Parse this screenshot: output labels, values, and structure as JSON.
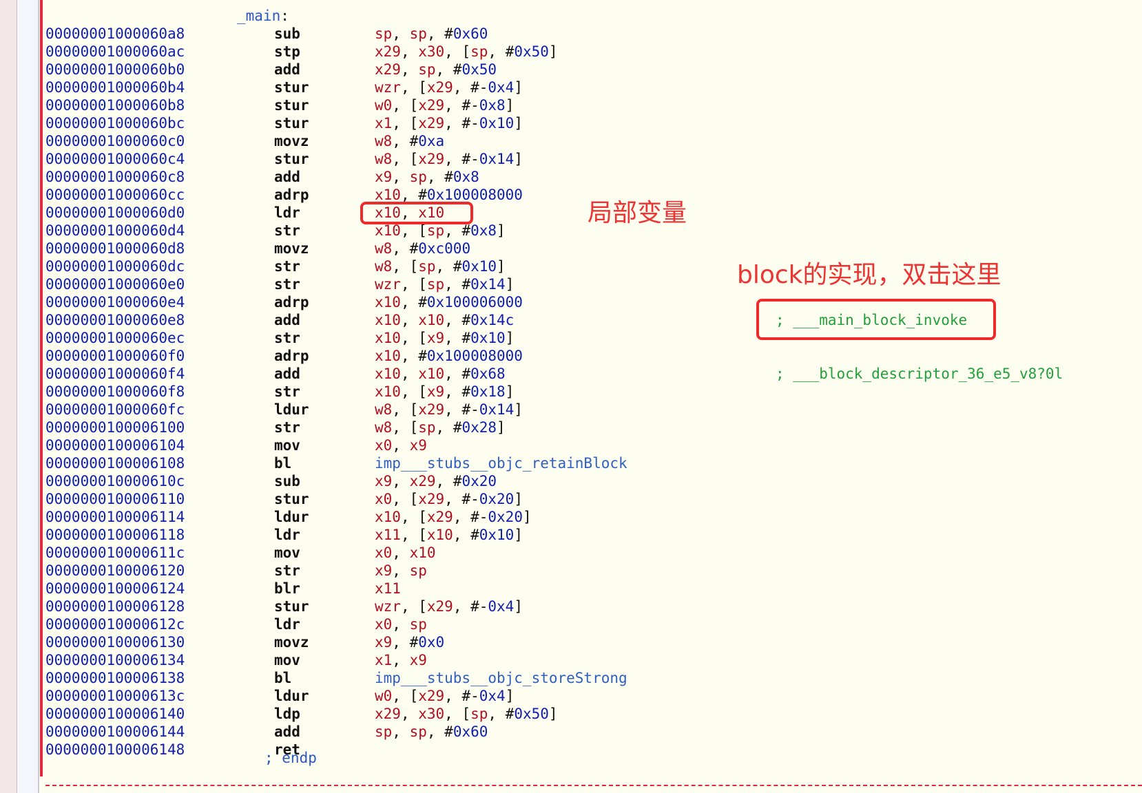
{
  "function_label": "_main",
  "instructions": [
    {
      "addr": "00000001000060a8",
      "mnemonic": "sub",
      "operands": [
        [
          "reg",
          "sp"
        ],
        [
          "pun",
          ", "
        ],
        [
          "reg",
          "sp"
        ],
        [
          "pun",
          ", #"
        ],
        [
          "num",
          "0x60"
        ]
      ]
    },
    {
      "addr": "00000001000060ac",
      "mnemonic": "stp",
      "operands": [
        [
          "reg",
          "x29"
        ],
        [
          "pun",
          ", "
        ],
        [
          "reg",
          "x30"
        ],
        [
          "pun",
          ", ["
        ],
        [
          "reg",
          "sp"
        ],
        [
          "pun",
          ", #"
        ],
        [
          "num",
          "0x50"
        ],
        [
          "pun",
          "]"
        ]
      ]
    },
    {
      "addr": "00000001000060b0",
      "mnemonic": "add",
      "operands": [
        [
          "reg",
          "x29"
        ],
        [
          "pun",
          ", "
        ],
        [
          "reg",
          "sp"
        ],
        [
          "pun",
          ", #"
        ],
        [
          "num",
          "0x50"
        ]
      ]
    },
    {
      "addr": "00000001000060b4",
      "mnemonic": "stur",
      "operands": [
        [
          "reg",
          "wzr"
        ],
        [
          "pun",
          ", ["
        ],
        [
          "reg",
          "x29"
        ],
        [
          "pun",
          ", #-"
        ],
        [
          "num",
          "0x4"
        ],
        [
          "pun",
          "]"
        ]
      ]
    },
    {
      "addr": "00000001000060b8",
      "mnemonic": "stur",
      "operands": [
        [
          "reg",
          "w0"
        ],
        [
          "pun",
          ", ["
        ],
        [
          "reg",
          "x29"
        ],
        [
          "pun",
          ", #-"
        ],
        [
          "num",
          "0x8"
        ],
        [
          "pun",
          "]"
        ]
      ]
    },
    {
      "addr": "00000001000060bc",
      "mnemonic": "stur",
      "operands": [
        [
          "reg",
          "x1"
        ],
        [
          "pun",
          ", ["
        ],
        [
          "reg",
          "x29"
        ],
        [
          "pun",
          ", #-"
        ],
        [
          "num",
          "0x10"
        ],
        [
          "pun",
          "]"
        ]
      ]
    },
    {
      "addr": "00000001000060c0",
      "mnemonic": "movz",
      "operands": [
        [
          "reg",
          "w8"
        ],
        [
          "pun",
          ", #"
        ],
        [
          "num",
          "0xa"
        ]
      ]
    },
    {
      "addr": "00000001000060c4",
      "mnemonic": "stur",
      "operands": [
        [
          "reg",
          "w8"
        ],
        [
          "pun",
          ", ["
        ],
        [
          "reg",
          "x29"
        ],
        [
          "pun",
          ", #-"
        ],
        [
          "num",
          "0x14"
        ],
        [
          "pun",
          "]"
        ]
      ]
    },
    {
      "addr": "00000001000060c8",
      "mnemonic": "add",
      "operands": [
        [
          "reg",
          "x9"
        ],
        [
          "pun",
          ", "
        ],
        [
          "reg",
          "sp"
        ],
        [
          "pun",
          ", #"
        ],
        [
          "num",
          "0x8"
        ]
      ]
    },
    {
      "addr": "00000001000060cc",
      "mnemonic": "adrp",
      "operands": [
        [
          "reg",
          "x10"
        ],
        [
          "pun",
          ", #"
        ],
        [
          "num",
          "0x100008000"
        ]
      ]
    },
    {
      "addr": "00000001000060d0",
      "mnemonic": "ldr",
      "operands": [
        [
          "reg",
          "x10"
        ],
        [
          "pun",
          ", "
        ],
        [
          "reg",
          "x10"
        ]
      ]
    },
    {
      "addr": "00000001000060d4",
      "mnemonic": "str",
      "operands": [
        [
          "reg",
          "x10"
        ],
        [
          "pun",
          ", ["
        ],
        [
          "reg",
          "sp"
        ],
        [
          "pun",
          ", #"
        ],
        [
          "num",
          "0x8"
        ],
        [
          "pun",
          "]"
        ]
      ]
    },
    {
      "addr": "00000001000060d8",
      "mnemonic": "movz",
      "operands": [
        [
          "reg",
          "w8"
        ],
        [
          "pun",
          ", #"
        ],
        [
          "num",
          "0xc000"
        ]
      ]
    },
    {
      "addr": "00000001000060dc",
      "mnemonic": "str",
      "operands": [
        [
          "reg",
          "w8"
        ],
        [
          "pun",
          ", ["
        ],
        [
          "reg",
          "sp"
        ],
        [
          "pun",
          ", #"
        ],
        [
          "num",
          "0x10"
        ],
        [
          "pun",
          "]"
        ]
      ]
    },
    {
      "addr": "00000001000060e0",
      "mnemonic": "str",
      "operands": [
        [
          "reg",
          "wzr"
        ],
        [
          "pun",
          ", ["
        ],
        [
          "reg",
          "sp"
        ],
        [
          "pun",
          ", #"
        ],
        [
          "num",
          "0x14"
        ],
        [
          "pun",
          "]"
        ]
      ]
    },
    {
      "addr": "00000001000060e4",
      "mnemonic": "adrp",
      "operands": [
        [
          "reg",
          "x10"
        ],
        [
          "pun",
          ", #"
        ],
        [
          "num",
          "0x100006000"
        ]
      ]
    },
    {
      "addr": "00000001000060e8",
      "mnemonic": "add",
      "operands": [
        [
          "reg",
          "x10"
        ],
        [
          "pun",
          ", "
        ],
        [
          "reg",
          "x10"
        ],
        [
          "pun",
          ", #"
        ],
        [
          "num",
          "0x14c"
        ]
      ]
    },
    {
      "addr": "00000001000060ec",
      "mnemonic": "str",
      "operands": [
        [
          "reg",
          "x10"
        ],
        [
          "pun",
          ", ["
        ],
        [
          "reg",
          "x9"
        ],
        [
          "pun",
          ", #"
        ],
        [
          "num",
          "0x10"
        ],
        [
          "pun",
          "]"
        ]
      ]
    },
    {
      "addr": "00000001000060f0",
      "mnemonic": "adrp",
      "operands": [
        [
          "reg",
          "x10"
        ],
        [
          "pun",
          ", #"
        ],
        [
          "num",
          "0x100008000"
        ]
      ]
    },
    {
      "addr": "00000001000060f4",
      "mnemonic": "add",
      "operands": [
        [
          "reg",
          "x10"
        ],
        [
          "pun",
          ", "
        ],
        [
          "reg",
          "x10"
        ],
        [
          "pun",
          ", #"
        ],
        [
          "num",
          "0x68"
        ]
      ]
    },
    {
      "addr": "00000001000060f8",
      "mnemonic": "str",
      "operands": [
        [
          "reg",
          "x10"
        ],
        [
          "pun",
          ", ["
        ],
        [
          "reg",
          "x9"
        ],
        [
          "pun",
          ", #"
        ],
        [
          "num",
          "0x18"
        ],
        [
          "pun",
          "]"
        ]
      ]
    },
    {
      "addr": "00000001000060fc",
      "mnemonic": "ldur",
      "operands": [
        [
          "reg",
          "w8"
        ],
        [
          "pun",
          ", ["
        ],
        [
          "reg",
          "x29"
        ],
        [
          "pun",
          ", #-"
        ],
        [
          "num",
          "0x14"
        ],
        [
          "pun",
          "]"
        ]
      ]
    },
    {
      "addr": "0000000100006100",
      "mnemonic": "str",
      "operands": [
        [
          "reg",
          "w8"
        ],
        [
          "pun",
          ", ["
        ],
        [
          "reg",
          "sp"
        ],
        [
          "pun",
          ", #"
        ],
        [
          "num",
          "0x28"
        ],
        [
          "pun",
          "]"
        ]
      ]
    },
    {
      "addr": "0000000100006104",
      "mnemonic": "mov",
      "operands": [
        [
          "reg",
          "x0"
        ],
        [
          "pun",
          ", "
        ],
        [
          "reg",
          "x9"
        ]
      ]
    },
    {
      "addr": "0000000100006108",
      "mnemonic": "bl",
      "operands": [
        [
          "sym",
          "imp___stubs__objc_retainBlock"
        ]
      ]
    },
    {
      "addr": "000000010000610c",
      "mnemonic": "sub",
      "operands": [
        [
          "reg",
          "x9"
        ],
        [
          "pun",
          ", "
        ],
        [
          "reg",
          "x29"
        ],
        [
          "pun",
          ", #"
        ],
        [
          "num",
          "0x20"
        ]
      ]
    },
    {
      "addr": "0000000100006110",
      "mnemonic": "stur",
      "operands": [
        [
          "reg",
          "x0"
        ],
        [
          "pun",
          ", ["
        ],
        [
          "reg",
          "x29"
        ],
        [
          "pun",
          ", #-"
        ],
        [
          "num",
          "0x20"
        ],
        [
          "pun",
          "]"
        ]
      ]
    },
    {
      "addr": "0000000100006114",
      "mnemonic": "ldur",
      "operands": [
        [
          "reg",
          "x10"
        ],
        [
          "pun",
          ", ["
        ],
        [
          "reg",
          "x29"
        ],
        [
          "pun",
          ", #-"
        ],
        [
          "num",
          "0x20"
        ],
        [
          "pun",
          "]"
        ]
      ]
    },
    {
      "addr": "0000000100006118",
      "mnemonic": "ldr",
      "operands": [
        [
          "reg",
          "x11"
        ],
        [
          "pun",
          ", ["
        ],
        [
          "reg",
          "x10"
        ],
        [
          "pun",
          ", #"
        ],
        [
          "num",
          "0x10"
        ],
        [
          "pun",
          "]"
        ]
      ]
    },
    {
      "addr": "000000010000611c",
      "mnemonic": "mov",
      "operands": [
        [
          "reg",
          "x0"
        ],
        [
          "pun",
          ", "
        ],
        [
          "reg",
          "x10"
        ]
      ]
    },
    {
      "addr": "0000000100006120",
      "mnemonic": "str",
      "operands": [
        [
          "reg",
          "x9"
        ],
        [
          "pun",
          ", "
        ],
        [
          "reg",
          "sp"
        ]
      ]
    },
    {
      "addr": "0000000100006124",
      "mnemonic": "blr",
      "operands": [
        [
          "reg",
          "x11"
        ]
      ]
    },
    {
      "addr": "0000000100006128",
      "mnemonic": "stur",
      "operands": [
        [
          "reg",
          "wzr"
        ],
        [
          "pun",
          ", ["
        ],
        [
          "reg",
          "x29"
        ],
        [
          "pun",
          ", #-"
        ],
        [
          "num",
          "0x4"
        ],
        [
          "pun",
          "]"
        ]
      ]
    },
    {
      "addr": "000000010000612c",
      "mnemonic": "ldr",
      "operands": [
        [
          "reg",
          "x0"
        ],
        [
          "pun",
          ", "
        ],
        [
          "reg",
          "sp"
        ]
      ]
    },
    {
      "addr": "0000000100006130",
      "mnemonic": "movz",
      "operands": [
        [
          "reg",
          "x9"
        ],
        [
          "pun",
          ", #"
        ],
        [
          "num",
          "0x0"
        ]
      ]
    },
    {
      "addr": "0000000100006134",
      "mnemonic": "mov",
      "operands": [
        [
          "reg",
          "x1"
        ],
        [
          "pun",
          ", "
        ],
        [
          "reg",
          "x9"
        ]
      ]
    },
    {
      "addr": "0000000100006138",
      "mnemonic": "bl",
      "operands": [
        [
          "sym",
          "imp___stubs__objc_storeStrong"
        ]
      ]
    },
    {
      "addr": "000000010000613c",
      "mnemonic": "ldur",
      "operands": [
        [
          "reg",
          "w0"
        ],
        [
          "pun",
          ", ["
        ],
        [
          "reg",
          "x29"
        ],
        [
          "pun",
          ", #-"
        ],
        [
          "num",
          "0x4"
        ],
        [
          "pun",
          "]"
        ]
      ]
    },
    {
      "addr": "0000000100006140",
      "mnemonic": "ldp",
      "operands": [
        [
          "reg",
          "x29"
        ],
        [
          "pun",
          ", "
        ],
        [
          "reg",
          "x30"
        ],
        [
          "pun",
          ", ["
        ],
        [
          "reg",
          "sp"
        ],
        [
          "pun",
          ", #"
        ],
        [
          "num",
          "0x50"
        ],
        [
          "pun",
          "]"
        ]
      ]
    },
    {
      "addr": "0000000100006144",
      "mnemonic": "add",
      "operands": [
        [
          "reg",
          "sp"
        ],
        [
          "pun",
          ", "
        ],
        [
          "reg",
          "sp"
        ],
        [
          "pun",
          ", #"
        ],
        [
          "num",
          "0x60"
        ]
      ]
    },
    {
      "addr": "0000000100006148",
      "mnemonic": "ret",
      "operands": []
    }
  ],
  "endp": "; endp",
  "annotations": {
    "local_variable": "局部变量",
    "block_impl": "block的实现，双击这里"
  },
  "comments": {
    "block_invoke": "; ___main_block_invoke",
    "block_descriptor": "; ___block_descriptor_36_e5_v8?0l"
  },
  "colors": {
    "background": "#fdfdf0",
    "address": "#1020a8",
    "register": "#b01020",
    "symbol": "#2f5fc0",
    "comment": "#22a03a",
    "annotation": "#ef2a2a"
  }
}
